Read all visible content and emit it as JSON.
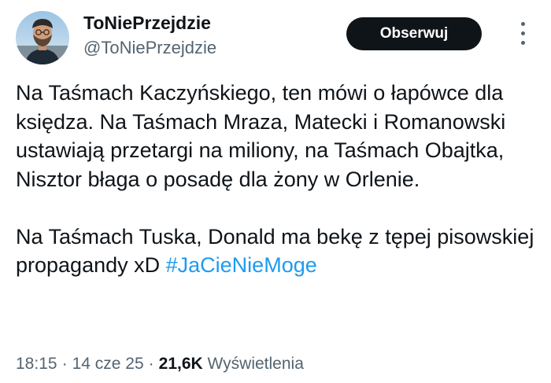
{
  "author": {
    "display_name": "ToNiePrzejdzie",
    "handle": "@ToNiePrzejdzie"
  },
  "follow_button": {
    "label": "Obserwuj"
  },
  "more_options": {
    "icon": "more-vertical-icon"
  },
  "tweet": {
    "paragraph_1": "Na Taśmach Kaczyńskiego, ten mówi o łapówce dla księdza. Na Taśmach Mraza, Matecki i Romanowski ustawiają przetargi na miliony, na Taśmach Obajtka, Nisztor błaga o posadę dla żony w Orlenie.",
    "paragraph_2_text": "Na Taśmach Tuska, Donald ma bekę z tępej pisowskiej propagandy xD",
    "hashtag": "#JaCieNieMoge"
  },
  "meta": {
    "time": "18:15",
    "separator": "·",
    "date": "14 cze 25",
    "views_count": "21,6K",
    "views_label": "Wyświetlenia"
  },
  "colors": {
    "text": "#0f1419",
    "secondary": "#536471",
    "link": "#1d9bf0",
    "button_bg": "#0f1419"
  }
}
